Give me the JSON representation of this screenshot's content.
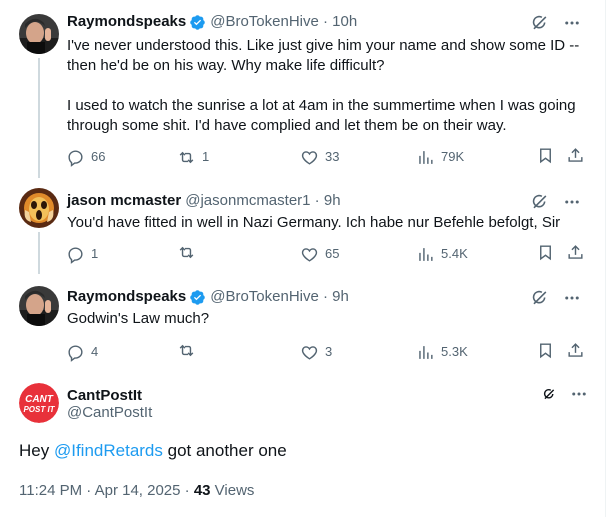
{
  "replies": [
    {
      "name": "Raymondspeaks",
      "handle": "@BroTokenHive",
      "time": "10h",
      "verified": true,
      "paragraphs": [
        "I've never understood this. Like just give him your name and show some ID -- then he'd be on his way. Why make life difficult?",
        "I used to watch the sunrise a lot at 4am in the summertime when I was going through some shit. I'd have complied and let them be on their way."
      ],
      "stats": {
        "replies": "66",
        "reposts": "1",
        "likes": "33",
        "views": "79K"
      }
    },
    {
      "name": "jason mcmaster",
      "handle": "@jasonmcmaster1",
      "time": "9h",
      "verified": false,
      "paragraphs": [
        "You'd have fitted in well in Nazi Germany. Ich habe nur Befehle befolgt, Sir"
      ],
      "stats": {
        "replies": "1",
        "reposts": "",
        "likes": "65",
        "views": "5.4K"
      }
    },
    {
      "name": "Raymondspeaks",
      "handle": "@BroTokenHive",
      "time": "9h",
      "verified": true,
      "paragraphs": [
        "Godwin's Law much?"
      ],
      "stats": {
        "replies": "4",
        "reposts": "",
        "likes": "3",
        "views": "5.3K"
      }
    }
  ],
  "main_post": {
    "name": "CantPostIt",
    "handle": "@CantPostIt",
    "avatar_text": [
      "CANT",
      "POST IT"
    ],
    "text_prefix": "Hey ",
    "mention": "@IfindRetards",
    "text_suffix": " got another one",
    "timestamp": "11:24 PM · Apr 14, 2025 · ",
    "views_count": "43",
    "views_label": " Views"
  },
  "colors": {
    "verified": "#1d9bf0",
    "secondary_text": "#536471",
    "mention": "#1d9bf0",
    "avatar_red": "#e8313a"
  },
  "icons": [
    "verified-badge-icon",
    "grok-icon",
    "more-icon",
    "reply-icon",
    "repost-icon",
    "like-icon",
    "views-icon",
    "bookmark-icon",
    "share-icon"
  ]
}
